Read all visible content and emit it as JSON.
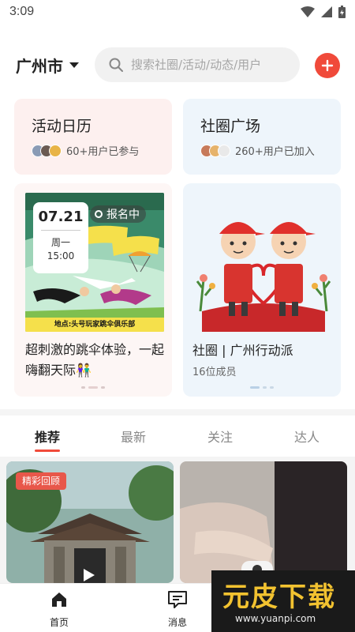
{
  "status_bar": {
    "time": "3:09"
  },
  "header": {
    "city": "广州市",
    "search_placeholder": "搜索社圈/活动/动态/用户"
  },
  "cards": {
    "calendar": {
      "title": "活动日历",
      "subtitle": "60+用户已参与"
    },
    "square": {
      "title": "社圈广场",
      "subtitle": "260+用户已加入"
    }
  },
  "promo_activity": {
    "date": "07.21",
    "weekday": "周一",
    "time": "15:00",
    "status": "报名中",
    "image_banner": "地点:头号玩家跳伞俱乐部",
    "caption": "超刺激的跳伞体验，一起嗨翻天际👫"
  },
  "promo_group": {
    "title": "社圈 | 广州行动派",
    "members": "16位成员"
  },
  "tabs": [
    {
      "label": "推荐"
    },
    {
      "label": "最新"
    },
    {
      "label": "关注"
    },
    {
      "label": "达人"
    }
  ],
  "feed": {
    "left_tag": "精彩回顾"
  },
  "bottom_nav": [
    {
      "label": "首页"
    },
    {
      "label": "消息"
    }
  ],
  "watermark": {
    "logo": "元皮下载",
    "url": "www.yuanpi.com"
  },
  "colors": {
    "accent": "#f04a3a",
    "calendar_card_bg": "#fdf0ef",
    "square_card_bg": "#eef5fb"
  }
}
